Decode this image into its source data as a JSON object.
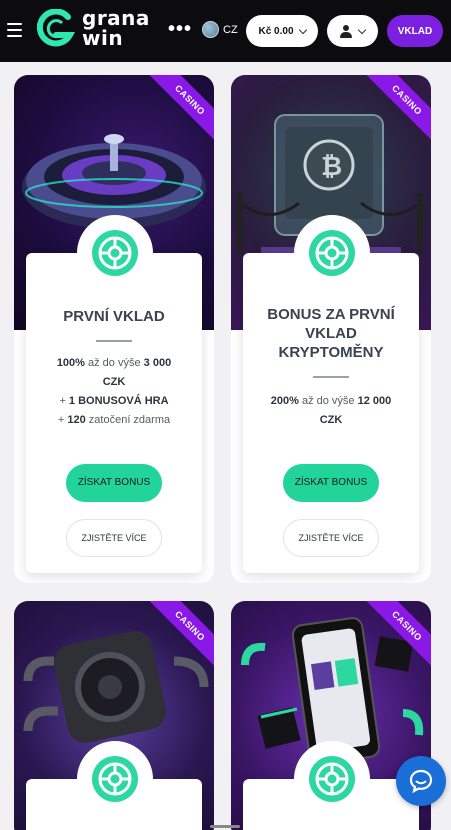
{
  "header": {
    "logo_text_line1": "grana",
    "logo_text_line2": "win",
    "more_label": "•••",
    "language": "CZ",
    "balance": "Kč 0.00",
    "deposit_label": "VKLAD"
  },
  "cards": [
    {
      "ribbon": "CASINO",
      "title": "PRVNÍ VKLAD",
      "desc_lines": [
        {
          "pre": "",
          "bold": "100%",
          "post": " až do výše ",
          "bold2": "3 000"
        },
        {
          "pre": "",
          "bold": "CZK",
          "post": "",
          "bold2": ""
        },
        {
          "pre": "+ ",
          "bold": "1 BONUSOVÁ HRA",
          "post": "",
          "bold2": ""
        },
        {
          "pre": "+ ",
          "bold": "120",
          "post": " zatočení zdarma",
          "bold2": ""
        }
      ],
      "primary_label": "ZÍSKAT BONUS",
      "secondary_label": "ZJISTĚTE VÍCE"
    },
    {
      "ribbon": "CASINO",
      "title_line1": "BONUS ZA PRVNÍ",
      "title_line2": "VKLAD",
      "title_line3": "KRYPTOMĚNY",
      "desc_lines": [
        {
          "pre": "",
          "bold": "200%",
          "post": " až do výše ",
          "bold2": "12 000"
        },
        {
          "pre": "",
          "bold": "CZK",
          "post": "",
          "bold2": ""
        }
      ],
      "primary_label": "ZÍSKAT BONUS",
      "secondary_label": "ZJISTĚTE VÍCE"
    },
    {
      "ribbon": "CASINO"
    },
    {
      "ribbon": "CASINO"
    }
  ],
  "colors": {
    "accent_green": "#22d49a",
    "deposit_purple": "#7b1fe0",
    "ribbon_purple": "#8a19e8",
    "chat_blue": "#1a6ed8"
  }
}
